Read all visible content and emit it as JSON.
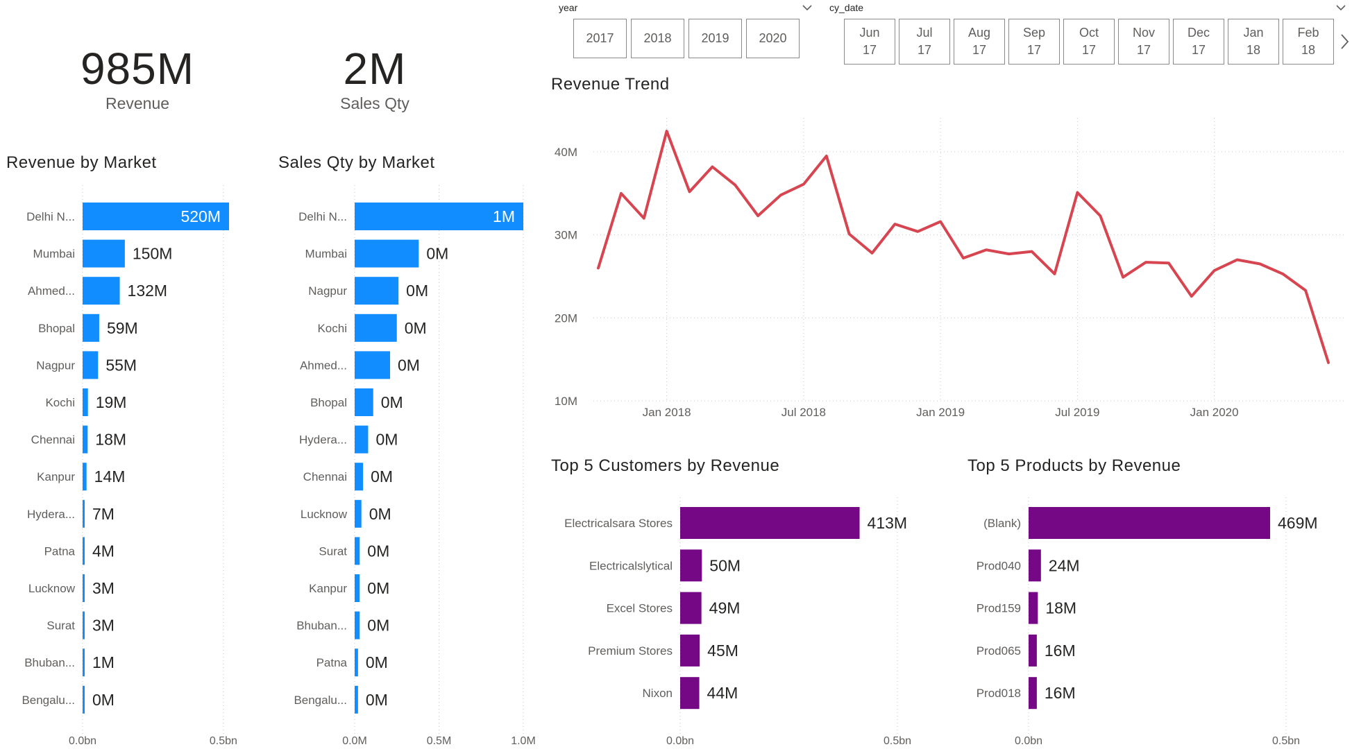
{
  "kpis": [
    {
      "value": "985M",
      "label": "Revenue"
    },
    {
      "value": "2M",
      "label": "Sales Qty"
    }
  ],
  "year_slicer": {
    "title": "year",
    "options": [
      "2017",
      "2018",
      "2019",
      "2020"
    ]
  },
  "date_slicer": {
    "title": "cy_date",
    "options": [
      {
        "month": "Jun",
        "year": "17"
      },
      {
        "month": "Jul",
        "year": "17"
      },
      {
        "month": "Aug",
        "year": "17"
      },
      {
        "month": "Sep",
        "year": "17"
      },
      {
        "month": "Oct",
        "year": "17"
      },
      {
        "month": "Nov",
        "year": "17"
      },
      {
        "month": "Dec",
        "year": "17"
      },
      {
        "month": "Jan",
        "year": "18"
      },
      {
        "month": "Feb",
        "year": "18"
      }
    ]
  },
  "icons": {
    "dropdown": "chevron-down-icon",
    "next": "chevron-right-icon"
  },
  "colors": {
    "market_bar": "#118DFF",
    "trend_line": "#D64550",
    "top5_bar": "#750985"
  },
  "chart_data": [
    {
      "id": "revenue_by_market",
      "type": "bar",
      "orientation": "horizontal",
      "title": "Revenue by Market",
      "categories": [
        "Delhi N...",
        "Mumbai",
        "Ahmed...",
        "Bhopal",
        "Nagpur",
        "Kochi",
        "Chennai",
        "Kanpur",
        "Hydera...",
        "Patna",
        "Lucknow",
        "Surat",
        "Bhuban...",
        "Bengalu..."
      ],
      "values": [
        520,
        150,
        132,
        59,
        55,
        19,
        18,
        14,
        7,
        4,
        3,
        3,
        1,
        0.3
      ],
      "value_unit": "M",
      "labels": [
        "520M",
        "150M",
        "132M",
        "59M",
        "55M",
        "19M",
        "18M",
        "14M",
        "7M",
        "4M",
        "3M",
        "3M",
        "1M",
        "0M"
      ],
      "xlim": [
        0,
        520
      ],
      "xticks": [
        0,
        500
      ],
      "xtick_labels": [
        "0.0bn",
        "0.5bn"
      ],
      "grid": true
    },
    {
      "id": "sales_qty_by_market",
      "type": "bar",
      "orientation": "horizontal",
      "title": "Sales Qty by Market",
      "categories": [
        "Delhi N...",
        "Mumbai",
        "Nagpur",
        "Kochi",
        "Ahmed...",
        "Bhopal",
        "Hydera...",
        "Chennai",
        "Lucknow",
        "Surat",
        "Kanpur",
        "Bhuban...",
        "Patna",
        "Bengalu..."
      ],
      "values": [
        1.0,
        0.38,
        0.26,
        0.25,
        0.21,
        0.11,
        0.08,
        0.05,
        0.04,
        0.03,
        0.03,
        0.03,
        0.02,
        0.02
      ],
      "value_unit": "M",
      "labels": [
        "1M",
        "0M",
        "0M",
        "0M",
        "0M",
        "0M",
        "0M",
        "0M",
        "0M",
        "0M",
        "0M",
        "0M",
        "0M",
        "0M"
      ],
      "xlim": [
        0,
        1.0
      ],
      "xticks": [
        0,
        0.5,
        1.0
      ],
      "xtick_labels": [
        "0.0M",
        "0.5M",
        "1.0M"
      ],
      "grid": true
    },
    {
      "id": "revenue_trend",
      "type": "line",
      "title": "Revenue Trend",
      "x": [
        "2017-10",
        "2017-11",
        "2017-12",
        "2018-01",
        "2018-02",
        "2018-03",
        "2018-04",
        "2018-05",
        "2018-06",
        "2018-07",
        "2018-08",
        "2018-09",
        "2018-10",
        "2018-11",
        "2018-12",
        "2019-01",
        "2019-02",
        "2019-03",
        "2019-04",
        "2019-05",
        "2019-06",
        "2019-07",
        "2019-08",
        "2019-09",
        "2019-10",
        "2019-11",
        "2019-12",
        "2020-01",
        "2020-02",
        "2020-03",
        "2020-04",
        "2020-05",
        "2020-06"
      ],
      "values": [
        26,
        35,
        32,
        42.5,
        35.2,
        38.2,
        36,
        32.3,
        34.8,
        36.1,
        39.5,
        30.1,
        27.8,
        31.3,
        30.4,
        31.6,
        27.2,
        28.2,
        27.7,
        28,
        25.3,
        35.1,
        32.3,
        24.9,
        26.7,
        26.6,
        22.6,
        25.7,
        27,
        26.5,
        25.3,
        23.3,
        14.6
      ],
      "value_unit": "M",
      "ylim": [
        10,
        42.5
      ],
      "yticks": [
        10,
        20,
        30,
        40
      ],
      "ytick_labels": [
        "10M",
        "20M",
        "30M",
        "40M"
      ],
      "xticks": [
        "2018-01",
        "2018-07",
        "2019-01",
        "2019-07",
        "2020-01"
      ],
      "xtick_labels": [
        "Jan 2018",
        "Jul 2018",
        "Jan 2019",
        "Jul 2019",
        "Jan 2020"
      ],
      "grid": true
    },
    {
      "id": "top5_customers",
      "type": "bar",
      "orientation": "horizontal",
      "title": "Top 5 Customers by Revenue",
      "categories": [
        "Electricalsara Stores",
        "Electricalslytical",
        "Excel Stores",
        "Premium Stores",
        "Nixon"
      ],
      "values": [
        413,
        50,
        49,
        45,
        44
      ],
      "value_unit": "M",
      "labels": [
        "413M",
        "50M",
        "49M",
        "45M",
        "44M"
      ],
      "xlim": [
        0,
        500
      ],
      "xticks": [
        0,
        500
      ],
      "xtick_labels": [
        "0.0bn",
        "0.5bn"
      ],
      "grid": true
    },
    {
      "id": "top5_products",
      "type": "bar",
      "orientation": "horizontal",
      "title": "Top 5 Products by Revenue",
      "categories": [
        "(Blank)",
        "Prod040",
        "Prod159",
        "Prod065",
        "Prod018"
      ],
      "values": [
        469,
        24,
        18,
        16,
        16
      ],
      "value_unit": "M",
      "labels": [
        "469M",
        "24M",
        "18M",
        "16M",
        "16M"
      ],
      "xlim": [
        0,
        500
      ],
      "xticks": [
        0,
        500
      ],
      "xtick_labels": [
        "0.0bn",
        "0.5bn"
      ],
      "grid": true
    }
  ]
}
